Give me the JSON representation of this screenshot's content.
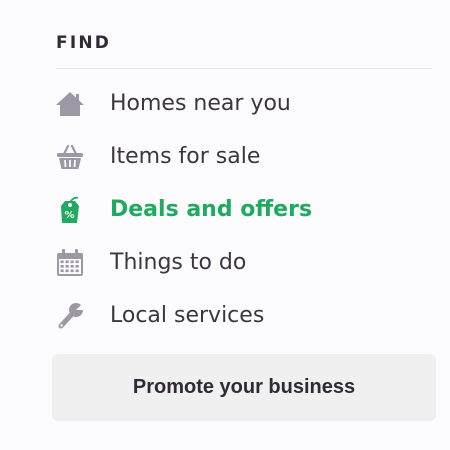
{
  "section": {
    "title": "FIND"
  },
  "nav": {
    "items": [
      {
        "label": "Homes near you",
        "icon": "home-icon",
        "active": false
      },
      {
        "label": "Items for sale",
        "icon": "basket-icon",
        "active": false
      },
      {
        "label": "Deals and offers",
        "icon": "price-tag-icon",
        "active": true
      },
      {
        "label": "Things to do",
        "icon": "calendar-icon",
        "active": false
      },
      {
        "label": "Local services",
        "icon": "wrench-icon",
        "active": false
      }
    ]
  },
  "promote": {
    "label": "Promote your business"
  },
  "colors": {
    "background": "#fcfbfe",
    "text": "#3b3641",
    "icon": "#9d99a4",
    "accent": "#1faa5f",
    "button_bg": "#f0f0f0"
  }
}
